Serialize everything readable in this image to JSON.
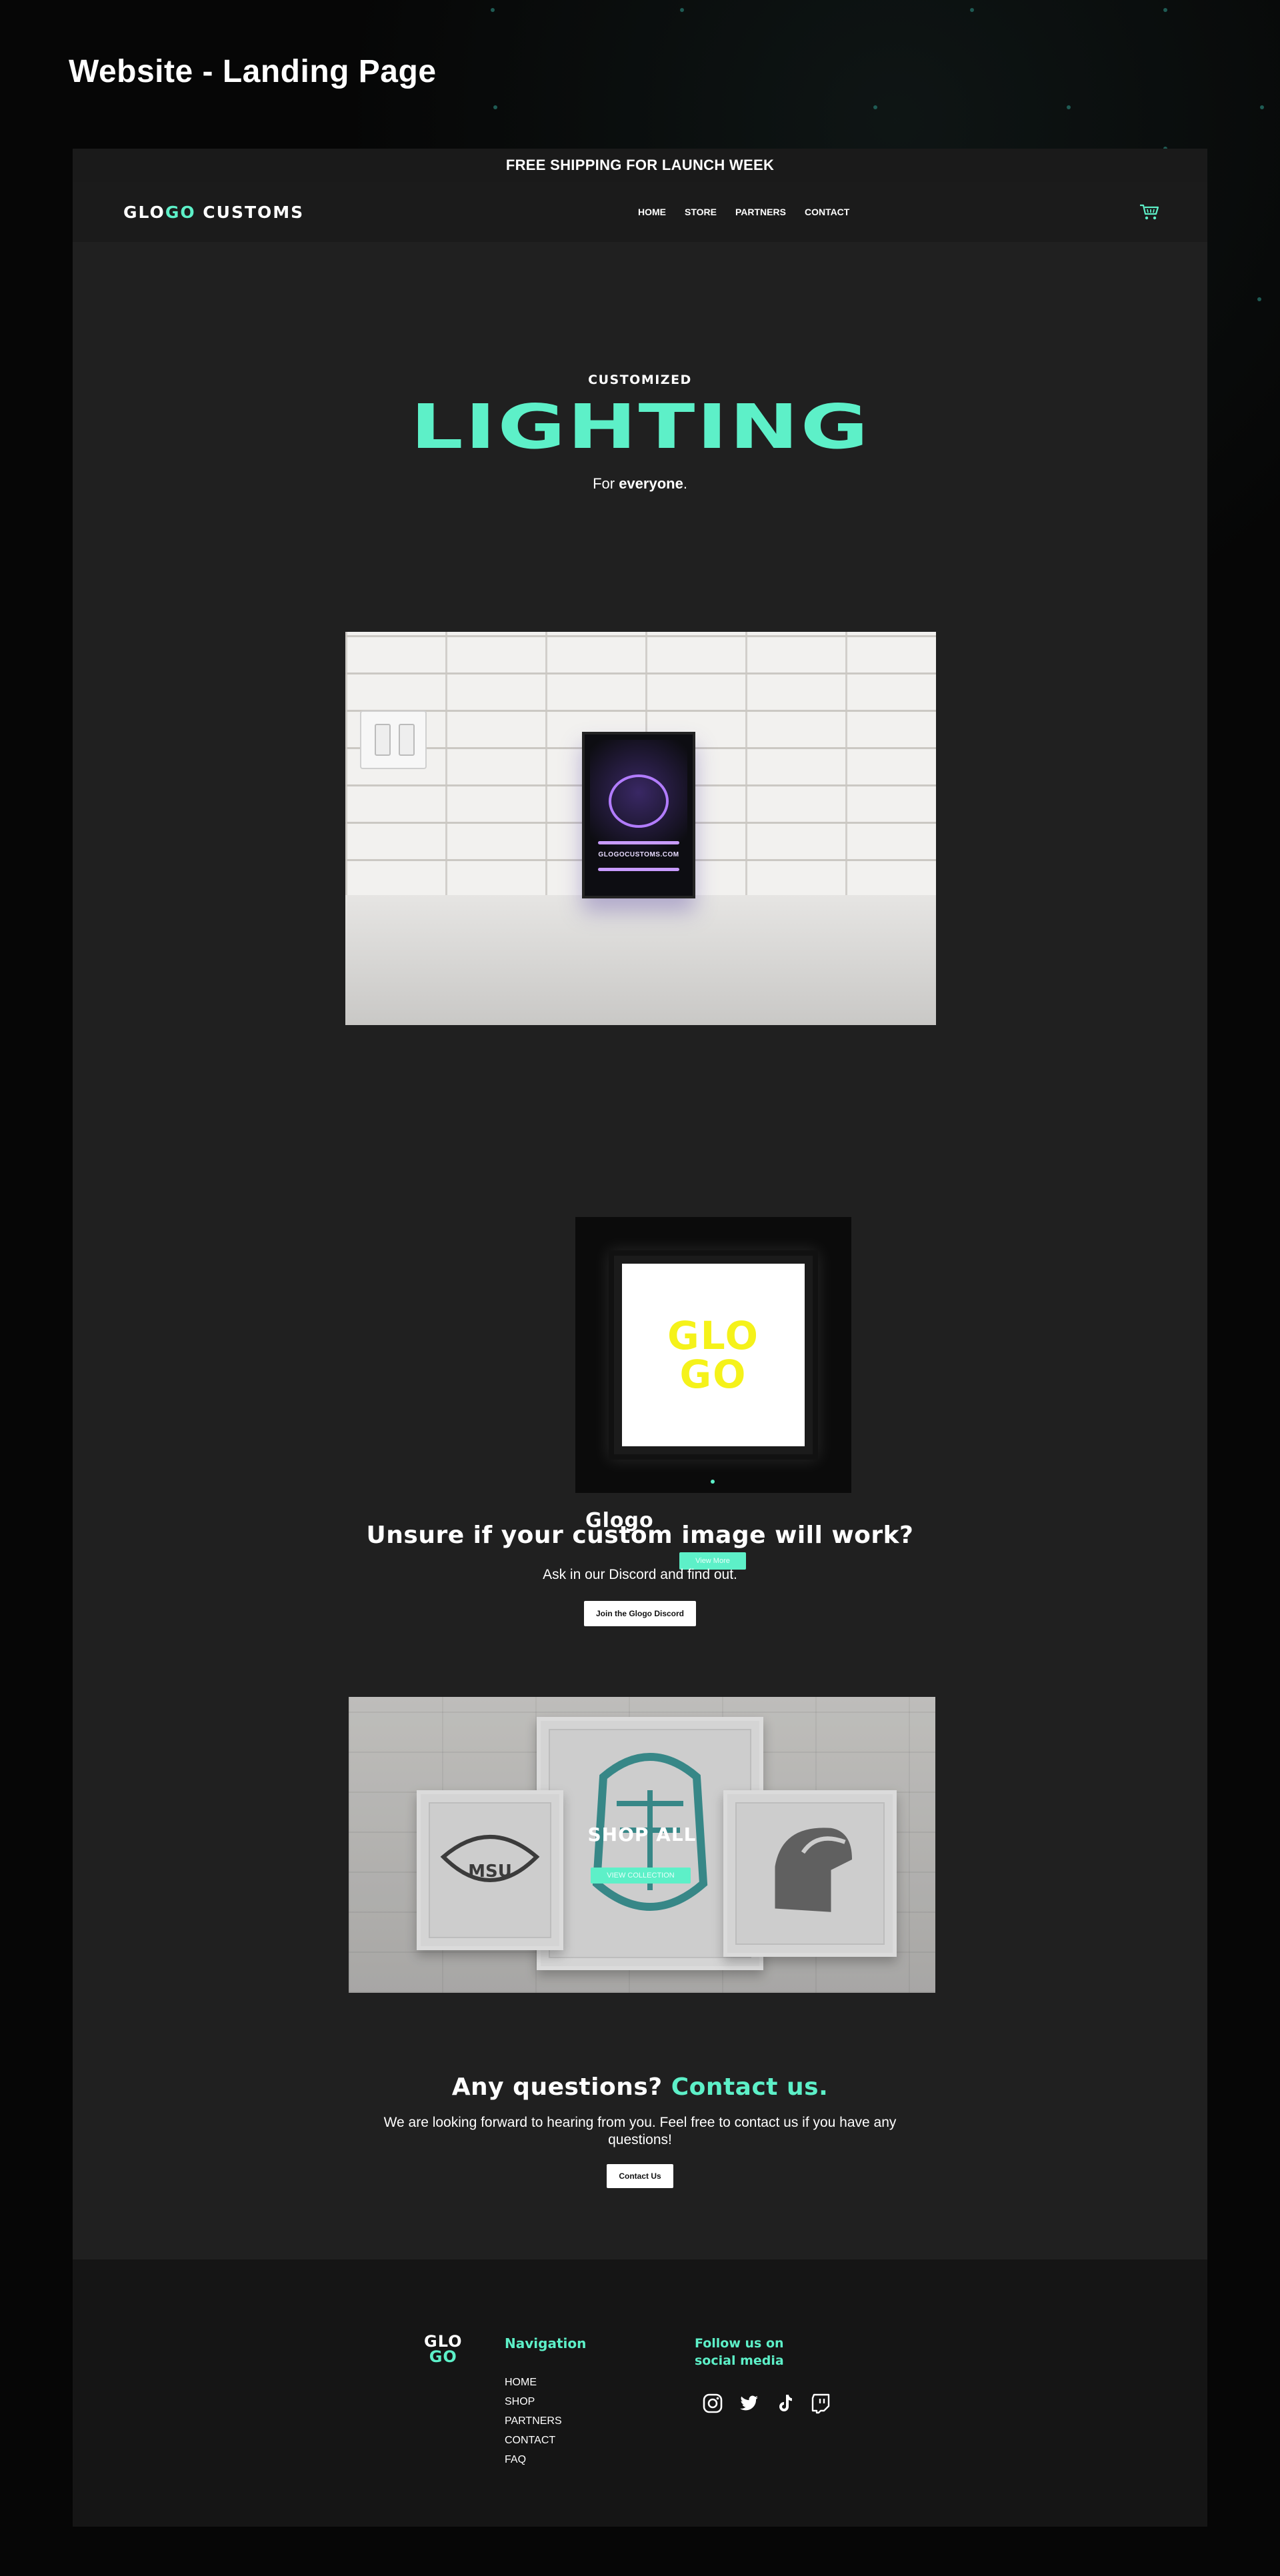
{
  "page_heading": "Website - Landing Page",
  "promo_bar": "FREE SHIPPING FOR LAUNCH WEEK",
  "header": {
    "logo_part1": "GLO",
    "logo_part2": "GO",
    "logo_part3": " CUSTOMS",
    "nav": [
      "HOME",
      "STORE",
      "PARTNERS",
      "CONTACT"
    ],
    "cart_icon": "cart-icon"
  },
  "hero": {
    "eyebrow": "CUSTOMIZED",
    "title": "LIGHTING",
    "tagline_prefix": "For ",
    "tagline_bold": "everyone",
    "tagline_suffix": "."
  },
  "hero_image": {
    "sign_text": "GLOGOCUSTOMS.COM"
  },
  "product": {
    "image_text": [
      "GLO",
      "GO"
    ],
    "name": "Glogo",
    "button": "View More"
  },
  "discord": {
    "heading": "Unsure if your custom image will work?",
    "subtext": "Ask in our Discord and find out.",
    "button": "Join the Glogo Discord"
  },
  "shop": {
    "title": "SHOP ALL",
    "button": "VIEW COLLECTION",
    "frame_text": "MSU"
  },
  "contact": {
    "heading_prefix": "Any questions? ",
    "heading_accent": "Contact us.",
    "text": "We are looking forward to hearing from you. Feel free to contact us if you have any questions!",
    "button": "Contact Us"
  },
  "footer": {
    "logo_line1": "GLO",
    "logo_line2": "GO",
    "nav_title": "Navigation",
    "nav_items": [
      "HOME",
      "SHOP",
      "PARTNERS",
      "CONTACT",
      "FAQ"
    ],
    "social_title": "Follow us on social media",
    "social_icons": [
      "instagram-icon",
      "twitter-icon",
      "tiktok-icon",
      "twitch-icon"
    ]
  },
  "colors": {
    "accent": "#5df0c8",
    "background": "#060606",
    "panel": "#202020",
    "footer": "#151515"
  }
}
